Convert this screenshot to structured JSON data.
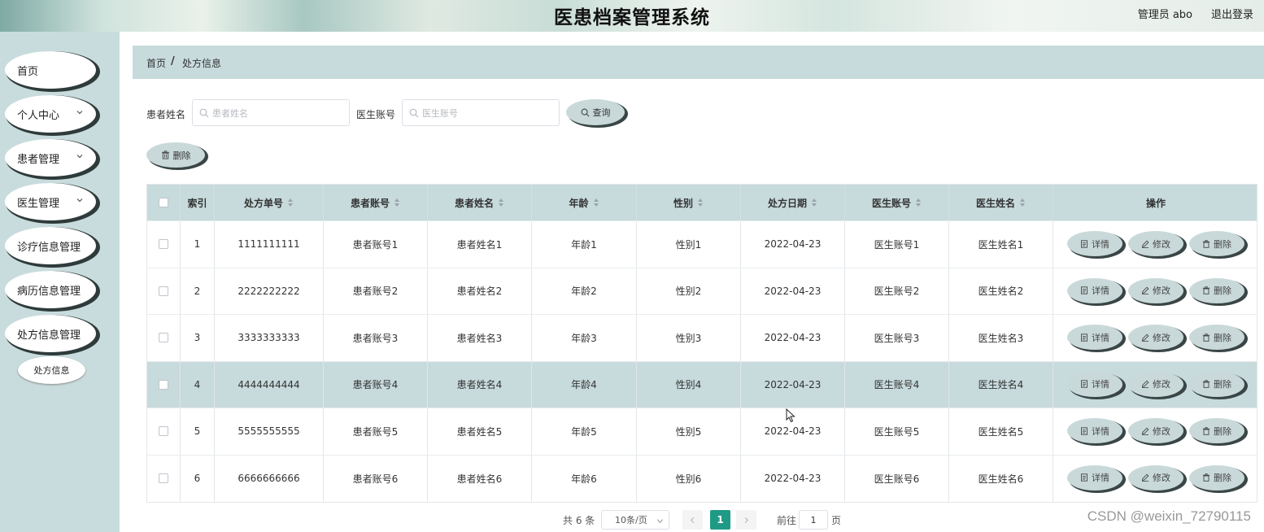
{
  "header": {
    "title": "医患档案管理系统",
    "user": "管理员 abo",
    "logout": "退出登录"
  },
  "sidebar": {
    "items": [
      {
        "label": "首页",
        "has_chevron": false
      },
      {
        "label": "个人中心",
        "has_chevron": true
      },
      {
        "label": "患者管理",
        "has_chevron": true
      },
      {
        "label": "医生管理",
        "has_chevron": true
      },
      {
        "label": "诊疗信息管理",
        "has_chevron": false
      },
      {
        "label": "病历信息管理",
        "has_chevron": false
      },
      {
        "label": "处方信息管理",
        "has_chevron": false
      }
    ],
    "sub_item": "处方信息"
  },
  "breadcrumb": {
    "home": "首页",
    "separator": "/",
    "current": "处方信息"
  },
  "search": {
    "patient_label": "患者姓名",
    "patient_placeholder": "患者姓名",
    "doctor_label": "医生账号",
    "doctor_placeholder": "医生账号",
    "query_button": "查询",
    "delete_button": "删除"
  },
  "table": {
    "headers": [
      "索引",
      "处方单号",
      "患者账号",
      "患者姓名",
      "年龄",
      "性别",
      "处方日期",
      "医生账号",
      "医生姓名",
      "操作"
    ],
    "rows": [
      [
        "1",
        "1111111111",
        "患者账号1",
        "患者姓名1",
        "年龄1",
        "性别1",
        "2022-04-23",
        "医生账号1",
        "医生姓名1"
      ],
      [
        "2",
        "2222222222",
        "患者账号2",
        "患者姓名2",
        "年龄2",
        "性别2",
        "2022-04-23",
        "医生账号2",
        "医生姓名2"
      ],
      [
        "3",
        "3333333333",
        "患者账号3",
        "患者姓名3",
        "年龄3",
        "性别3",
        "2022-04-23",
        "医生账号3",
        "医生姓名3"
      ],
      [
        "4",
        "4444444444",
        "患者账号4",
        "患者姓名4",
        "年龄4",
        "性别4",
        "2022-04-23",
        "医生账号4",
        "医生姓名4"
      ],
      [
        "5",
        "5555555555",
        "患者账号5",
        "患者姓名5",
        "年龄5",
        "性别5",
        "2022-04-23",
        "医生账号5",
        "医生姓名5"
      ],
      [
        "6",
        "6666666666",
        "患者账号6",
        "患者姓名6",
        "年龄6",
        "性别6",
        "2022-04-23",
        "医生账号6",
        "医生姓名6"
      ]
    ],
    "highlighted_row": 4,
    "actions": {
      "detail": "详情",
      "edit": "修改",
      "delete": "删除"
    }
  },
  "pagination": {
    "total": "共 6 条",
    "page_size": "10条/页",
    "current_page": "1",
    "goto_prefix": "前往",
    "goto_value": "1",
    "goto_suffix": "页"
  },
  "watermark": "CSDN @weixin_72790115",
  "colors": {
    "accent": "#1f9a86",
    "sidebar_bg": "#c9dcdd",
    "header_row_bg": "#c7dadc",
    "button_bg": "#c9d9da"
  }
}
